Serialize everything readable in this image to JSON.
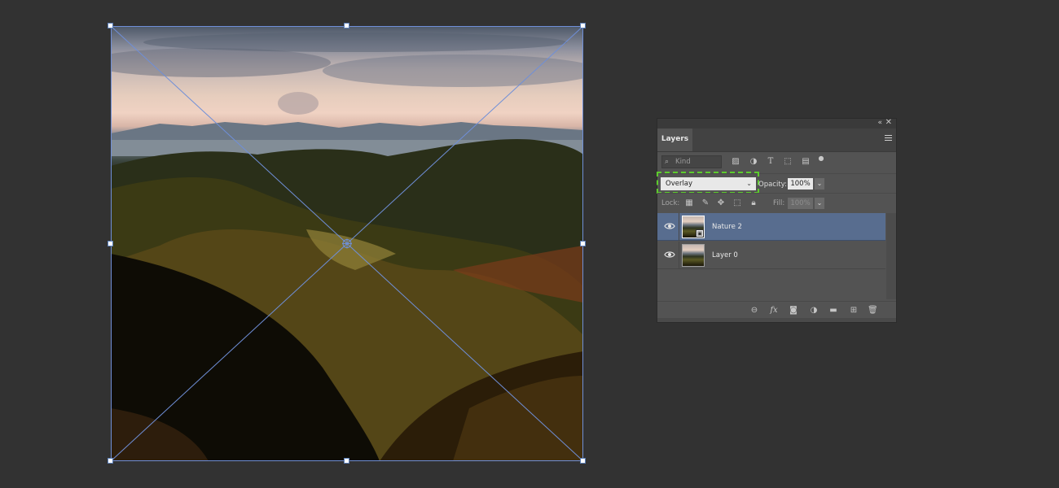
{
  "canvas": {
    "photo_name": "hills-landscape"
  },
  "layers_panel": {
    "title": "Layers",
    "collapse_glyph": "«",
    "close_glyph": "✕",
    "filter": {
      "placeholder": "Kind",
      "icons": [
        "image-filter-icon",
        "adjustment-filter-icon",
        "type-filter-icon",
        "shape-filter-icon",
        "smart-object-filter-icon",
        "filter-toggle-icon"
      ]
    },
    "blend_mode": "Overlay",
    "opacity_label": "Opacity:",
    "opacity_value": "100%",
    "lock_label": "Lock:",
    "fill_label": "Fill:",
    "fill_value": "100%",
    "layers": [
      {
        "name": "Nature 2",
        "selected": true,
        "visible": true,
        "smart_object": true
      },
      {
        "name": "Layer 0",
        "selected": false,
        "visible": true,
        "smart_object": false
      }
    ],
    "footer_icons": [
      "link-layers-icon",
      "fx-icon",
      "add-mask-icon",
      "new-adjustment-icon",
      "new-group-icon",
      "new-layer-icon",
      "delete-layer-icon"
    ],
    "accent_colors": {
      "selection": "#586d8f",
      "highlight": "#5dcb2d",
      "transform_line": "#6f8fd8"
    }
  }
}
